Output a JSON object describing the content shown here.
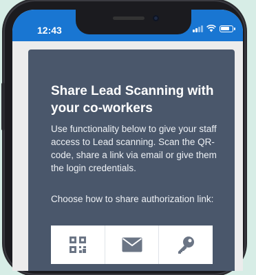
{
  "status_bar": {
    "time": "12:43",
    "icons": [
      "signal-icon",
      "wifi-icon",
      "battery-icon"
    ],
    "color": "#1976d2"
  },
  "card": {
    "title": "Share Lead Scanning with your co-workers",
    "description": "Use functionality below to give your staff access to Lead scanning. Scan the QR-code, share a link via email or give them the login credentials.",
    "choose_label": "Choose how to share authorization link:",
    "background": "#4a576b"
  },
  "share_options": [
    {
      "icon": "qr-code-icon"
    },
    {
      "icon": "email-icon"
    },
    {
      "icon": "key-icon"
    }
  ]
}
